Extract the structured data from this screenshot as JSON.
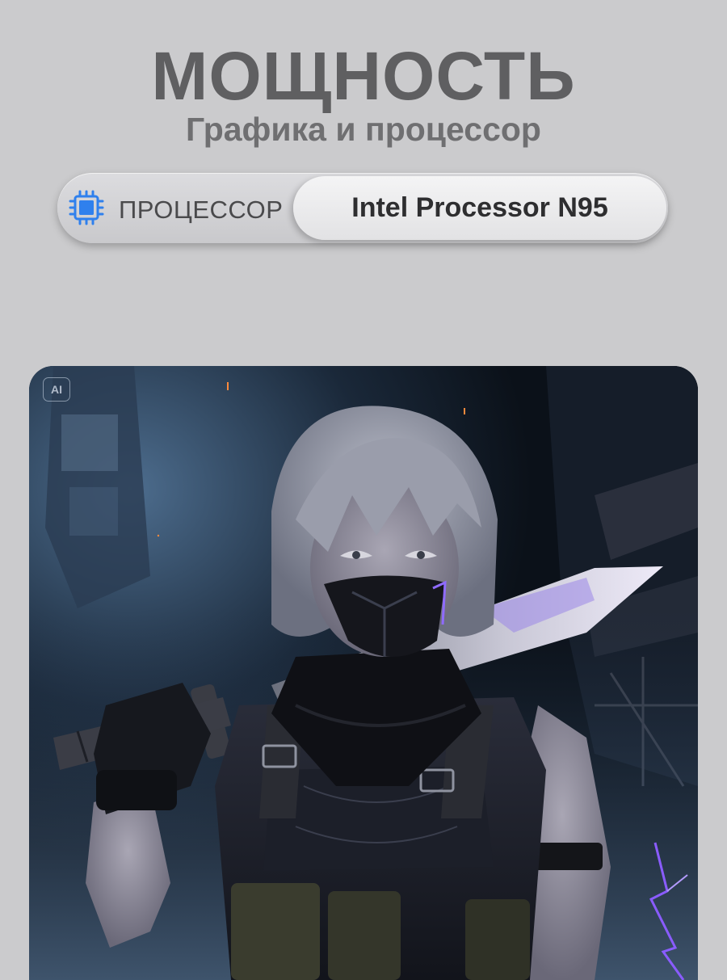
{
  "header": {
    "title": "МОЩНОСТЬ",
    "subtitle": "Графика и процессор"
  },
  "spec": {
    "icon": "cpu-icon",
    "label": "ПРОЦЕССОР",
    "value": "Intel Processor N95"
  },
  "artwork": {
    "badge": "AI"
  },
  "colors": {
    "background": "#cbcbcd",
    "title": "#5f5f61",
    "accent_icon": "#2f80ed",
    "lightning": "#8a5cff"
  }
}
